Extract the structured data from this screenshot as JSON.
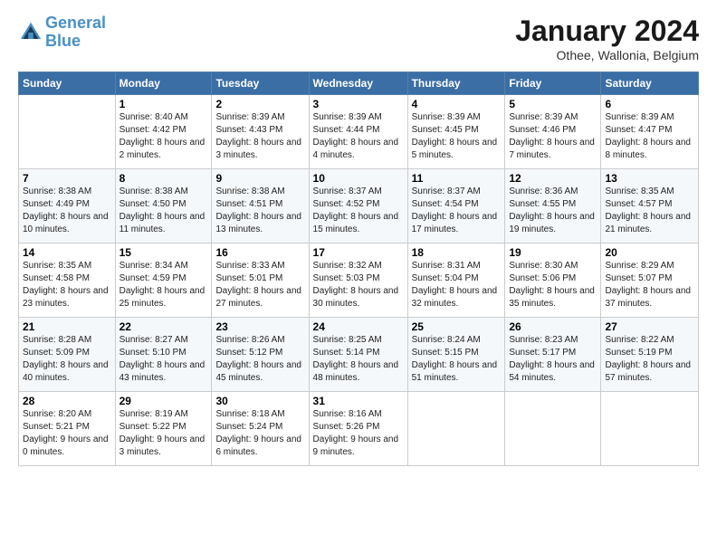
{
  "logo": {
    "line1": "General",
    "line2": "Blue"
  },
  "header": {
    "month": "January 2024",
    "location": "Othee, Wallonia, Belgium"
  },
  "weekdays": [
    "Sunday",
    "Monday",
    "Tuesday",
    "Wednesday",
    "Thursday",
    "Friday",
    "Saturday"
  ],
  "weeks": [
    [
      {
        "day": "",
        "sunrise": "",
        "sunset": "",
        "daylight": ""
      },
      {
        "day": "1",
        "sunrise": "Sunrise: 8:40 AM",
        "sunset": "Sunset: 4:42 PM",
        "daylight": "Daylight: 8 hours and 2 minutes."
      },
      {
        "day": "2",
        "sunrise": "Sunrise: 8:39 AM",
        "sunset": "Sunset: 4:43 PM",
        "daylight": "Daylight: 8 hours and 3 minutes."
      },
      {
        "day": "3",
        "sunrise": "Sunrise: 8:39 AM",
        "sunset": "Sunset: 4:44 PM",
        "daylight": "Daylight: 8 hours and 4 minutes."
      },
      {
        "day": "4",
        "sunrise": "Sunrise: 8:39 AM",
        "sunset": "Sunset: 4:45 PM",
        "daylight": "Daylight: 8 hours and 5 minutes."
      },
      {
        "day": "5",
        "sunrise": "Sunrise: 8:39 AM",
        "sunset": "Sunset: 4:46 PM",
        "daylight": "Daylight: 8 hours and 7 minutes."
      },
      {
        "day": "6",
        "sunrise": "Sunrise: 8:39 AM",
        "sunset": "Sunset: 4:47 PM",
        "daylight": "Daylight: 8 hours and 8 minutes."
      }
    ],
    [
      {
        "day": "7",
        "sunrise": "Sunrise: 8:38 AM",
        "sunset": "Sunset: 4:49 PM",
        "daylight": "Daylight: 8 hours and 10 minutes."
      },
      {
        "day": "8",
        "sunrise": "Sunrise: 8:38 AM",
        "sunset": "Sunset: 4:50 PM",
        "daylight": "Daylight: 8 hours and 11 minutes."
      },
      {
        "day": "9",
        "sunrise": "Sunrise: 8:38 AM",
        "sunset": "Sunset: 4:51 PM",
        "daylight": "Daylight: 8 hours and 13 minutes."
      },
      {
        "day": "10",
        "sunrise": "Sunrise: 8:37 AM",
        "sunset": "Sunset: 4:52 PM",
        "daylight": "Daylight: 8 hours and 15 minutes."
      },
      {
        "day": "11",
        "sunrise": "Sunrise: 8:37 AM",
        "sunset": "Sunset: 4:54 PM",
        "daylight": "Daylight: 8 hours and 17 minutes."
      },
      {
        "day": "12",
        "sunrise": "Sunrise: 8:36 AM",
        "sunset": "Sunset: 4:55 PM",
        "daylight": "Daylight: 8 hours and 19 minutes."
      },
      {
        "day": "13",
        "sunrise": "Sunrise: 8:35 AM",
        "sunset": "Sunset: 4:57 PM",
        "daylight": "Daylight: 8 hours and 21 minutes."
      }
    ],
    [
      {
        "day": "14",
        "sunrise": "Sunrise: 8:35 AM",
        "sunset": "Sunset: 4:58 PM",
        "daylight": "Daylight: 8 hours and 23 minutes."
      },
      {
        "day": "15",
        "sunrise": "Sunrise: 8:34 AM",
        "sunset": "Sunset: 4:59 PM",
        "daylight": "Daylight: 8 hours and 25 minutes."
      },
      {
        "day": "16",
        "sunrise": "Sunrise: 8:33 AM",
        "sunset": "Sunset: 5:01 PM",
        "daylight": "Daylight: 8 hours and 27 minutes."
      },
      {
        "day": "17",
        "sunrise": "Sunrise: 8:32 AM",
        "sunset": "Sunset: 5:03 PM",
        "daylight": "Daylight: 8 hours and 30 minutes."
      },
      {
        "day": "18",
        "sunrise": "Sunrise: 8:31 AM",
        "sunset": "Sunset: 5:04 PM",
        "daylight": "Daylight: 8 hours and 32 minutes."
      },
      {
        "day": "19",
        "sunrise": "Sunrise: 8:30 AM",
        "sunset": "Sunset: 5:06 PM",
        "daylight": "Daylight: 8 hours and 35 minutes."
      },
      {
        "day": "20",
        "sunrise": "Sunrise: 8:29 AM",
        "sunset": "Sunset: 5:07 PM",
        "daylight": "Daylight: 8 hours and 37 minutes."
      }
    ],
    [
      {
        "day": "21",
        "sunrise": "Sunrise: 8:28 AM",
        "sunset": "Sunset: 5:09 PM",
        "daylight": "Daylight: 8 hours and 40 minutes."
      },
      {
        "day": "22",
        "sunrise": "Sunrise: 8:27 AM",
        "sunset": "Sunset: 5:10 PM",
        "daylight": "Daylight: 8 hours and 43 minutes."
      },
      {
        "day": "23",
        "sunrise": "Sunrise: 8:26 AM",
        "sunset": "Sunset: 5:12 PM",
        "daylight": "Daylight: 8 hours and 45 minutes."
      },
      {
        "day": "24",
        "sunrise": "Sunrise: 8:25 AM",
        "sunset": "Sunset: 5:14 PM",
        "daylight": "Daylight: 8 hours and 48 minutes."
      },
      {
        "day": "25",
        "sunrise": "Sunrise: 8:24 AM",
        "sunset": "Sunset: 5:15 PM",
        "daylight": "Daylight: 8 hours and 51 minutes."
      },
      {
        "day": "26",
        "sunrise": "Sunrise: 8:23 AM",
        "sunset": "Sunset: 5:17 PM",
        "daylight": "Daylight: 8 hours and 54 minutes."
      },
      {
        "day": "27",
        "sunrise": "Sunrise: 8:22 AM",
        "sunset": "Sunset: 5:19 PM",
        "daylight": "Daylight: 8 hours and 57 minutes."
      }
    ],
    [
      {
        "day": "28",
        "sunrise": "Sunrise: 8:20 AM",
        "sunset": "Sunset: 5:21 PM",
        "daylight": "Daylight: 9 hours and 0 minutes."
      },
      {
        "day": "29",
        "sunrise": "Sunrise: 8:19 AM",
        "sunset": "Sunset: 5:22 PM",
        "daylight": "Daylight: 9 hours and 3 minutes."
      },
      {
        "day": "30",
        "sunrise": "Sunrise: 8:18 AM",
        "sunset": "Sunset: 5:24 PM",
        "daylight": "Daylight: 9 hours and 6 minutes."
      },
      {
        "day": "31",
        "sunrise": "Sunrise: 8:16 AM",
        "sunset": "Sunset: 5:26 PM",
        "daylight": "Daylight: 9 hours and 9 minutes."
      },
      {
        "day": "",
        "sunrise": "",
        "sunset": "",
        "daylight": ""
      },
      {
        "day": "",
        "sunrise": "",
        "sunset": "",
        "daylight": ""
      },
      {
        "day": "",
        "sunrise": "",
        "sunset": "",
        "daylight": ""
      }
    ]
  ]
}
